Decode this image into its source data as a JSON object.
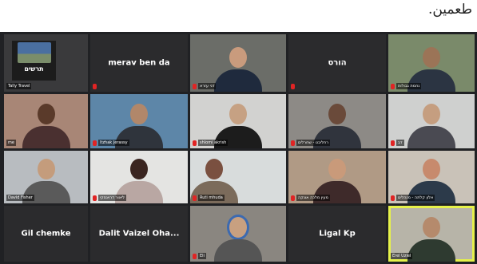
{
  "caption": "طعمين.",
  "tiles": [
    {
      "id": "t1",
      "center": "",
      "label": "Tally Travel",
      "logo": "תרשים"
    },
    {
      "id": "t2",
      "center": "merav ben da",
      "label": ""
    },
    {
      "id": "t3",
      "center": "",
      "label": "דני עזרא"
    },
    {
      "id": "t4",
      "center": "הורס",
      "label": ""
    },
    {
      "id": "t5",
      "center": "",
      "label": "נחמת גבולות"
    },
    {
      "id": "t6",
      "center": "",
      "label": "me"
    },
    {
      "id": "t7",
      "center": "",
      "label": "Itzhak Jerassy"
    },
    {
      "id": "t8",
      "center": "",
      "label": "shlomi akrish"
    },
    {
      "id": "t9",
      "center": "",
      "label": "רחליבט - שחרלים"
    },
    {
      "id": "t10",
      "center": "",
      "label": "דב"
    },
    {
      "id": "t11",
      "center": "",
      "label": "David Fisher"
    },
    {
      "id": "t12",
      "center": "",
      "label": "ליאור דרוינסקי"
    },
    {
      "id": "t13",
      "center": "",
      "label": "Ruti mhuda"
    },
    {
      "id": "t14",
      "center": "",
      "label": "מעין מלכה אונקה"
    },
    {
      "id": "t15",
      "center": "",
      "label": "אלון קלתה - מנהלים"
    },
    {
      "id": "t16",
      "center": "Gil chemke",
      "label": ""
    },
    {
      "id": "t17",
      "center": "Dalit Vaizel Oha...",
      "label": ""
    },
    {
      "id": "t18",
      "center": "",
      "label": "Eli"
    },
    {
      "id": "t19",
      "center": "Ligal Kp",
      "label": ""
    },
    {
      "id": "t20",
      "center": "",
      "label": "Erel Uziel"
    }
  ]
}
